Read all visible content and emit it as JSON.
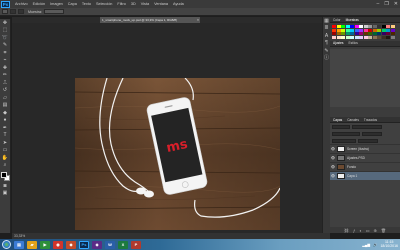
{
  "app": {
    "logo": "Ps"
  },
  "menu": {
    "items": [
      "Archivo",
      "Edición",
      "Imagen",
      "Capa",
      "Texto",
      "Selección",
      "Filtro",
      "3D",
      "Vista",
      "Ventana",
      "Ayuda"
    ]
  },
  "window_controls": {
    "minimize": "–",
    "restore": "❐",
    "close": "✕"
  },
  "options": {
    "label": "Muestra:"
  },
  "document": {
    "tab_title": "1_smartphone_mock_up.psd @ 33,3% (Capa 1, RGB/8)",
    "close": "×"
  },
  "status": {
    "zoom": "33,33%"
  },
  "panels": {
    "color_tabs": [
      "Color",
      "Muestras"
    ],
    "adjust_tabs": [
      "Ajustes",
      "Estilos"
    ],
    "layers_tabs": [
      "Capas",
      "Canales",
      "Trazados"
    ]
  },
  "swatch_colors": [
    "#ff0000",
    "#ffff00",
    "#00ff00",
    "#00ffff",
    "#0000ff",
    "#ff00ff",
    "#ffffff",
    "#cccccc",
    "#999999",
    "#666666",
    "#333333",
    "#000000",
    "#ff8080",
    "#ffcc80",
    "#ff3300",
    "#ff9900",
    "#ccff00",
    "#33ff99",
    "#00ccff",
    "#3366ff",
    "#9933ff",
    "#ff3399",
    "#cc0000",
    "#cc6600",
    "#99cc00",
    "#00cc66",
    "#0099cc",
    "#6600cc",
    "#990000",
    "#996600",
    "#669900",
    "#009966",
    "#006699",
    "#330099",
    "#990066",
    "#663300",
    "#336600",
    "#006633",
    "#003366",
    "#330066",
    "#660033",
    "#4d2600",
    "#ffcccc",
    "#ffe5cc",
    "#ffffcc",
    "#ccffcc",
    "#ccffff",
    "#cce5ff",
    "#e5ccff",
    "#ffcce5",
    "#c8b89a",
    "#8c7355",
    "#5e4a36",
    "#3b2e22",
    "#1f1812",
    "#7f7f7f"
  ],
  "layers": [
    {
      "name": "Screen (Ilustra)",
      "thumb": "white",
      "selected": false
    },
    {
      "name": "Ajustes.PSD",
      "thumb": "gray",
      "selected": false
    },
    {
      "name": "Fondo",
      "thumb": "wood",
      "selected": false
    },
    {
      "name": "Capa 1",
      "thumb": "white",
      "selected": true
    }
  ],
  "screen_logo": "ms",
  "taskbar": {
    "clock_time": "11:15",
    "clock_date": "18/10/2016"
  },
  "colors": {
    "accent": "#31a8ff",
    "logo_red": "#d81f2a",
    "wood": "#6b4a31"
  }
}
